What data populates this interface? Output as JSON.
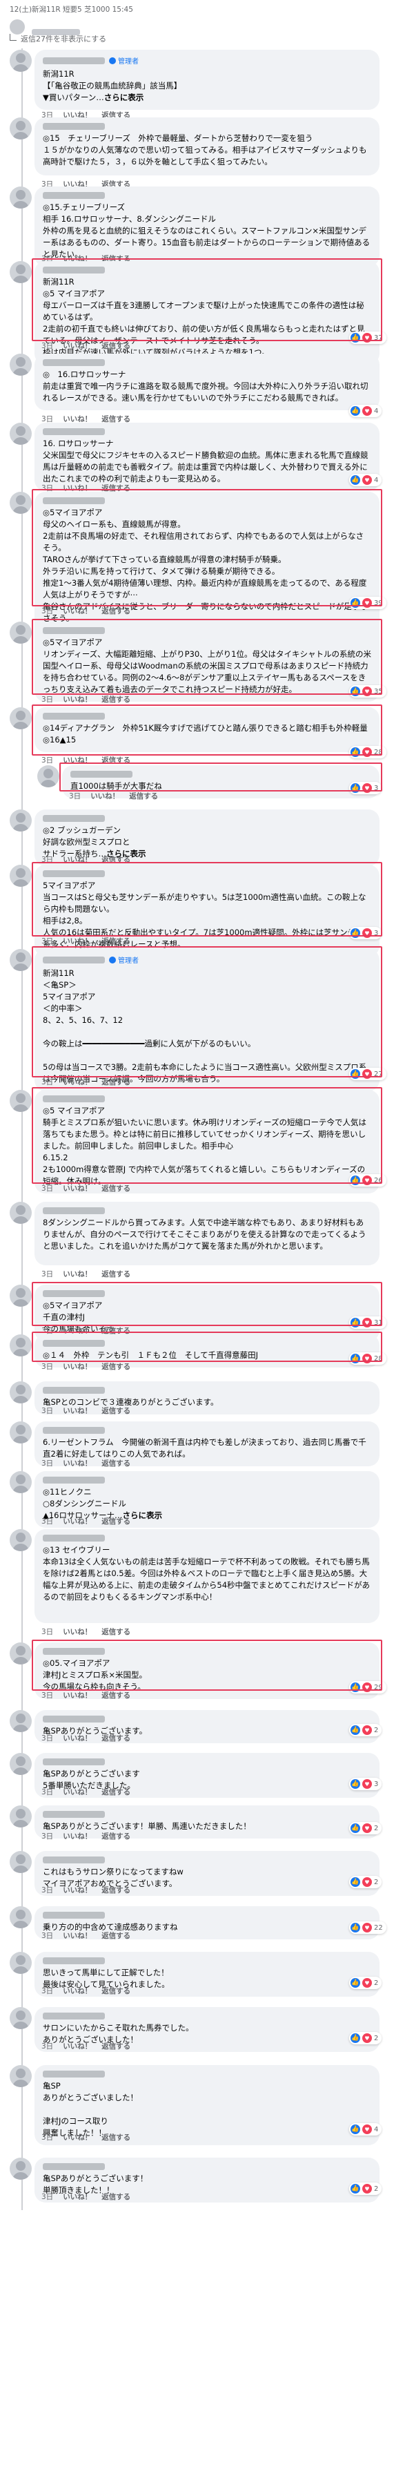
{
  "header": {
    "subtitle": "12(土)新潟11R 短要5 芝1000 15:45",
    "reply_bar": "返信27件を非表示にする",
    "admin_badge": "管理者"
  },
  "actions": {
    "like": "いいね！",
    "reply": "返信する"
  },
  "comments": [
    {
      "admin": "管理者",
      "text": "新潟11R\n【「亀谷敬正の競馬血統辞典」該当馬】\n▼買いパターン…",
      "more": "さらに表示",
      "time": "3日"
    },
    {
      "text": "◎15　チェリーブリーズ　外枠で最軽量、ダートから芝替わりで一変を狙う\n１５がかなりの人気薄なので思い切って狙ってみる。相手はアイビスサマーダッシュよりも高時計で駆けた５，３，６以外を軸として手広く狙ってみたい。",
      "time": "3日"
    },
    {
      "text": "◎15.チェリーブリーズ\n相手 16.ロサロッサーナ、8.ダンシングニードル\n外枠の馬を見ると血統的に狙えそうなのはこれくらい。スマートファルコン×米国型サンデー系はあるものの、ダート寄り。15血音も前走はダートからのローテーションで期待値あると見たい。",
      "time": "3日"
    },
    {
      "text": "新潟11R\n◎5 マイヨアポア\n母エバーローズは千直を3連勝してオープンまで駆け上がった快速馬でこの条件の適性は秘めているはず。\n2走前の初千直でも終いは伸びており、前の使い方が低く良馬場ならもっと走れたはずと見ている。母父はノーザンテーストでメイトリサ芝を走れそう。\n枠は内目だが速い馬が外にいて隊列がバラけるような想を1つ。",
      "react": "37",
      "time": "3日"
    },
    {
      "text": "◎　16.ロサロッサーナ\n前走は重賞で唯一内ラチに進路を取る競馬で度外視。今回は大外枠に入り外ラチ沿い取れ切れるレースができる。速い馬を行かせてもいいので外ラチにこだわる競馬できれば。",
      "react": "4",
      "time": "3日"
    },
    {
      "text": "16. ロサロッサーナ\n父米国型で母父にフジキセキの入るスピード勝負歓迎の血統。馬体に恵まれる牝馬で直線競馬は斤量軽めの前走でも善戦タイプ。前走は重賞で内枠は厳しく、大外替わりで買える外に出たこれまでの枠の利で前走よりも一変見込める。",
      "react": "4",
      "time": "3日"
    },
    {
      "text": "◎5マイヨアポア\n母父のヘイロー系も、直線競馬が得意。\n2走前は不良馬場の好走で、それ程信用されておらず、内枠でもあるので人気は上がらなさそう。\nTAROさんが挙げて下さっている直線競馬が得意の津村騎手が騎乗。\n外ラチ沿いに馬を持って行けて、タメて弾ける騎乗が期待できる。\n推定1〜3番人気が4期待値薄い理想、内枠。最近内枠が直線競馬を走ってるので、ある程度人気は上がりそうですが⋯\n亀谷さんのアドバイスに従うと、ブリーダー寄りにならないので内枠だとスピードが足りなさそう。\n母は15枠から外全部と父ロードカナロア6を。特に16を厚めに。",
      "react": "39",
      "time": "3日"
    },
    {
      "text": "◎5マイヨアポア\nリオンディーズ、大幅距離短縮、上がりP30、上がり1位。母父はタイキシャトルの系統の米国型ヘイロー系、母母父はWoodmanの系統の米国ミスプロで母系はあまりスピード持続力を持ち合わせている。同例の2〜4.6〜8がデンサア重以上ステイヤー馬もあるスペースをきっちり支え込みて着も過去のデータでこれ持つスピード持続力が好走。",
      "react": "35",
      "time": "3日"
    },
    {
      "text": "◎14ディアナグラン　外枠51K厩今すげで逃げてひと踏ん張りできると踏む相手も外枠軽量◎16▲15",
      "react": "28",
      "time": "3日"
    },
    {
      "text": "直1000は騎手が大事だね",
      "react": "3",
      "time": "3日"
    },
    {
      "text": "◎2 ブッシュガーデン\n好調な欧州型ミスプロと\nサドラー系持ち…",
      "more": "さらに表示",
      "time": "3日"
    },
    {
      "text": "5マイヨアポア\n当コースはSと母父も芝サンデー系が走りやすい。5は芝1000m適性高い血統。この鞍上なら内枠も問題ない。\n相手は2,8。\n人気の16は菊田系だと反動出やすいタイプ。7は芝1000m適性疑問。外枠には芝サンデー系多く、内枠が複数絡むレースと予想。",
      "react": "3",
      "time": "3日"
    },
    {
      "admin": "管理者",
      "text": "新潟11R\n＜亀SP＞\n5マイヨアポア\n＜的中率＞\n8、2、5、16、7、12\n\n今の鞍上は━━━━━━━━━━━━━過剰に人気が下がるのもいい。\n\n5の母は当コースで3勝。2走前も本命にしたように当コース適性高い。父欧州型ミスプロ系は今開催の当コース好調。今回の方が馬場も合う。",
      "react": "27",
      "time": "3日"
    },
    {
      "text": "◎5 マイヨアポア\n騎手とミスプロ系が狙いたいに思います。休み明けリオンディーズの短縮ローテ今で人気は落ちてもまた思う。枠とは特に前日に推移していてせっかくリオンディーズ、期待を思いしました。前回申しました。前回申しました。相手中心\n6.15.2\n2も1000m得意な菅原J で内枠で人気が落ちてくれると嬉しい。こちらもリオンディーズの短縮。休み明け。",
      "react": "26",
      "time": "3日"
    },
    {
      "text": "8ダンシングニードルから買ってみます。人気で中途半端な枠でもあり、あまり好材料もありませんが、自分のペースで行けてそこそこまりあがりを使える計算なので走ってくるようと思いました。これを追いかけた馬がコケて翼を落また馬が外れかと思います。",
      "time": "3日"
    },
    {
      "text": "◎5マイヨアポア\n千直の津村J\n今の馬場も合いそう",
      "react": "31",
      "time": "3日"
    },
    {
      "text": "◎１４　外枠　テンも引　１Ｆも２位　そして千直得意藤田J",
      "react": "28",
      "time": "3日"
    },
    {
      "text": "亀SPとのコンビで３連複ありがとうございます。",
      "time": "3日"
    },
    {
      "text": "6.リーゼントフラム　今開催の新潟千直は内枠でも差しが決まっており、過去同じ馬番で千直2着に好走してはりこの人気であれば。",
      "time": "3日"
    },
    {
      "text": "◎11ヒノクニ\n○8ダンシングニードル\n▲16ロサロッサーナ…",
      "more": "さらに表示",
      "time": "3日"
    },
    {
      "text": "◎13 セイウブリー\n本命13は全く人気ないもの前走は苦手な短縮ローテで杯不利あっての敗戦。それでも勝ち馬を除けば2着馬とは0.5差。今回は外枠＆ベストのローテで臨むと上手く届き見込め5勝。大幅な上昇が見込める上に、前走の走破タイムから54秒中盤でまとめてこれだけスピードがあるので前回をよりもくるるキングマンボ系中心！",
      "time": "3日"
    },
    {
      "text": "◎05.マイヨアポア\n津村Jとミスプロ系×米国型。\n今の馬場なら枠も向きそう。",
      "react": "29",
      "time": "3日"
    },
    {
      "text": "亀SPありがとうございます。",
      "react": "2",
      "time": "3日"
    },
    {
      "text": "亀SPありがとうございます\n5番単勝いただきました。",
      "react": "3",
      "time": "3日"
    },
    {
      "text": "亀SPありがとうございます！単勝、馬連いただきました！",
      "react": "2",
      "time": "3日"
    },
    {
      "text": "これはもうサロン祭りになってますねw\nマイヨアポアおめでとうございます。",
      "react": "2",
      "time": "3日"
    },
    {
      "text": "乗り方の的中含めて達成感ありますね",
      "react": "22",
      "time": "3日"
    },
    {
      "text": "思いきって馬単にして正解でした！\n最後は安心して見ていられました。",
      "react": "2",
      "time": "3日"
    },
    {
      "text": "サロンにいたからこそ取れた馬券でした。\nありがとうございました！",
      "react": "2",
      "time": "3日"
    },
    {
      "text": "亀SP\nありがとうございました！\n\n津村Jのコース取り\n興奮しました！！",
      "react": "4",
      "time": "3日"
    },
    {
      "text": "亀SPありがとうございます！\n単勝頂きました！！",
      "react": "2",
      "time": "3日"
    }
  ]
}
